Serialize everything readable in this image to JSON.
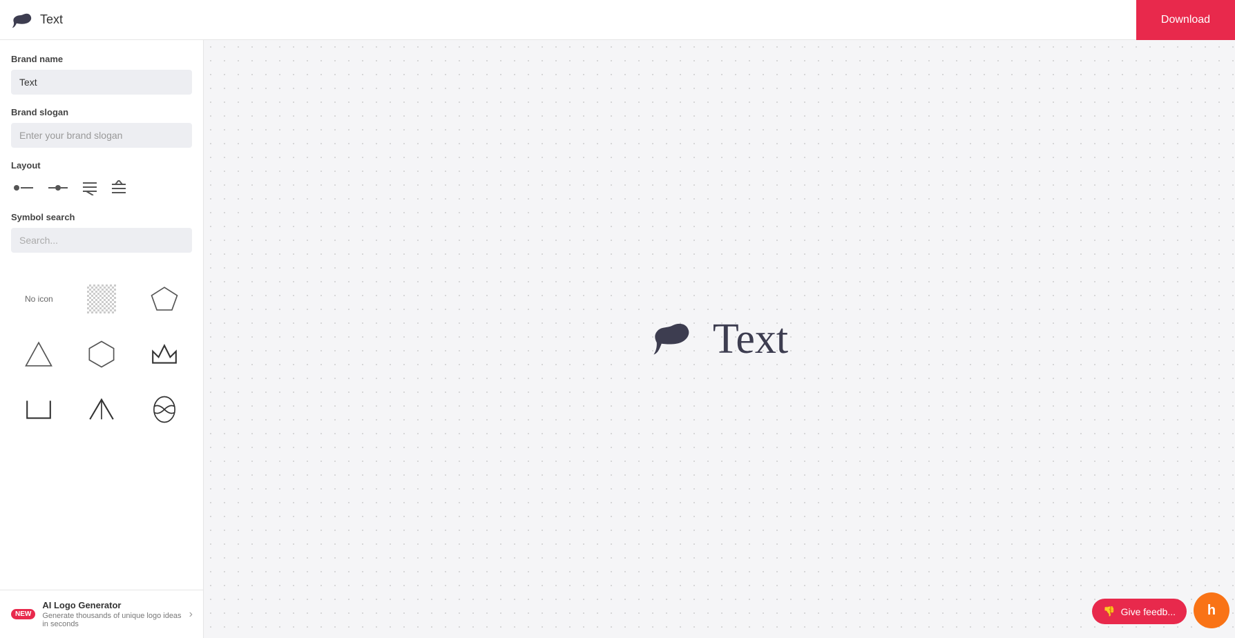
{
  "header": {
    "title": "Text",
    "download_label": "Download"
  },
  "sidebar": {
    "brand_name_label": "Brand name",
    "brand_name_value": "Text",
    "brand_slogan_label": "Brand slogan",
    "brand_slogan_placeholder": "Enter your brand slogan",
    "layout_label": "Layout",
    "symbol_search_label": "Symbol search",
    "search_placeholder": "Search...",
    "no_icon_label": "No icon"
  },
  "canvas": {
    "logo_text": "Text"
  },
  "ai_banner": {
    "badge": "NEW",
    "title": "AI Logo Generator",
    "description": "Generate thousands of unique logo ideas in seconds"
  },
  "feedback": {
    "label": "Give feedb..."
  },
  "icons": {
    "search": "🔍",
    "chevron_right": "›",
    "thumbs_down": "👎"
  },
  "colors": {
    "accent": "#e8294c",
    "logo_color": "#3d3d50",
    "sidebar_bg": "#edeef2",
    "canvas_dot": "#cccccc"
  }
}
